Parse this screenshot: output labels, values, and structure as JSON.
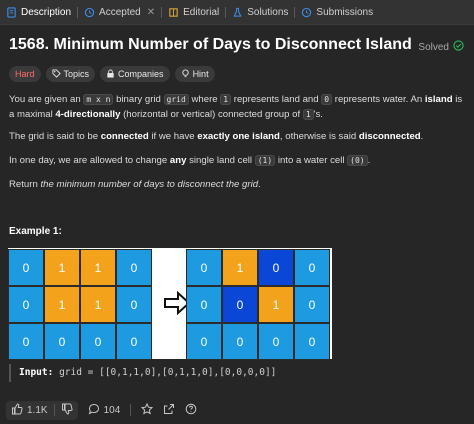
{
  "tabs": [
    {
      "label": "Description",
      "icon": "document-icon"
    },
    {
      "label": "Accepted",
      "icon": "history-icon"
    },
    {
      "label": "Editorial",
      "icon": "book-icon"
    },
    {
      "label": "Solutions",
      "icon": "flask-icon"
    },
    {
      "label": "Submissions",
      "icon": "history-icon"
    }
  ],
  "problem": {
    "title": "1568. Minimum Number of Days to Disconnect Island",
    "status": "Solved"
  },
  "chips": {
    "difficulty": "Hard",
    "topics": "Topics",
    "companies": "Companies",
    "hint": "Hint"
  },
  "description": {
    "p1_a": "You are given an ",
    "p1_code1": "m x n",
    "p1_b": " binary grid ",
    "p1_code2": "grid",
    "p1_c": " where ",
    "p1_code3": "1",
    "p1_d": " represents land and ",
    "p1_code4": "0",
    "p1_e": " represents water. An ",
    "p1_bold1": "island",
    "p1_f": " is a maximal ",
    "p1_bold2": "4-directionally",
    "p1_g": " (horizontal or vertical) connected group of ",
    "p1_code5": "1",
    "p1_h": "'s.",
    "p2_a": "The grid is said to be ",
    "p2_bold1": "connected",
    "p2_b": " if we have ",
    "p2_bold2": "exactly one island",
    "p2_c": ", otherwise is said ",
    "p2_bold3": "disconnected",
    "p2_d": ".",
    "p3_a": "In one day, we are allowed to change ",
    "p3_bold": "any",
    "p3_b": " single land cell ",
    "p3_code1": "(1)",
    "p3_c": " into a water cell ",
    "p3_code2": "(0)",
    "p3_d": ".",
    "p4_a": "Return ",
    "p4_em": "the minimum number of days to disconnect the grid",
    "p4_b": "."
  },
  "example": {
    "title": "Example 1:",
    "grid_before": [
      [
        0,
        1,
        1,
        0
      ],
      [
        0,
        1,
        1,
        0
      ],
      [
        0,
        0,
        0,
        0
      ]
    ],
    "grid_after": [
      [
        0,
        1,
        0,
        0
      ],
      [
        0,
        0,
        1,
        0
      ],
      [
        0,
        0,
        0,
        0
      ]
    ],
    "highlight_after": [
      [
        0,
        0,
        1,
        0
      ],
      [
        0,
        1,
        0,
        0
      ],
      [
        0,
        0,
        0,
        0
      ]
    ],
    "input_label": "Input:",
    "input_value": "grid = [[0,1,1,0],[0,1,1,0],[0,0,0,0]]"
  },
  "colors": {
    "water": "#1e9be0",
    "land": "#f2a31b",
    "changed": "#0b47d6",
    "hard": "#ff6b6b"
  },
  "footer": {
    "likes": "1.1K",
    "comments": "104"
  }
}
